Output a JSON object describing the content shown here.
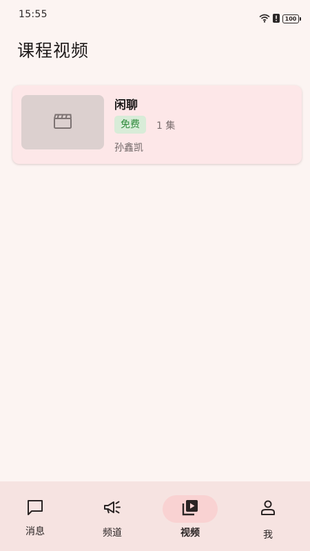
{
  "status_bar": {
    "time": "15:55",
    "battery": "100"
  },
  "page": {
    "title": "课程视频"
  },
  "course": {
    "name": "闲聊",
    "badge": "免费",
    "episodes": "1 集",
    "teacher": "孙鑫凯"
  },
  "nav": {
    "items": [
      {
        "label": "消息",
        "icon": "message-icon"
      },
      {
        "label": "频道",
        "icon": "megaphone-icon"
      },
      {
        "label": "视频",
        "icon": "video-library-icon",
        "active": true
      },
      {
        "label": "我",
        "icon": "person-icon"
      }
    ]
  },
  "colors": {
    "background": "#fcf4f2",
    "card": "#fde7e8",
    "badge_bg": "#d8ecd8",
    "badge_text": "#2f8a3b",
    "nav_bg": "#f6e3e1",
    "nav_active": "#f9d2d2"
  }
}
